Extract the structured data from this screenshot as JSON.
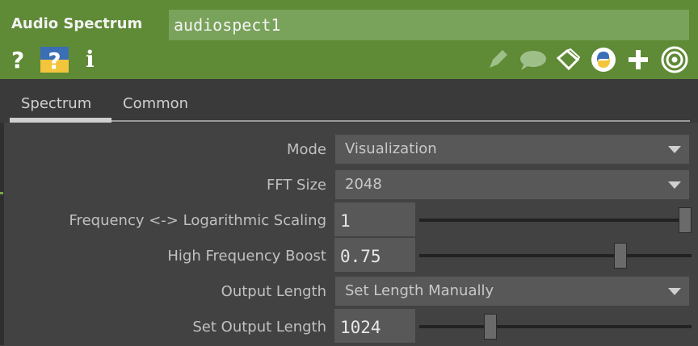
{
  "operator": {
    "type": "Audio Spectrum",
    "name": "audiospect1"
  },
  "header_icons": {
    "left": [
      "help-icon",
      "python-help-icon",
      "info-icon"
    ],
    "right": [
      "edit-icon",
      "comment-icon",
      "clone-icon",
      "python-icon",
      "add-icon",
      "target-icon"
    ]
  },
  "tabs": [
    {
      "label": "Spectrum",
      "active": true
    },
    {
      "label": "Common",
      "active": false
    }
  ],
  "params": {
    "mode": {
      "label": "Mode",
      "value": "Visualization"
    },
    "fft_size": {
      "label": "FFT Size",
      "value": "2048"
    },
    "log_scaling": {
      "label": "Frequency <-> Logarithmic Scaling",
      "value": "1",
      "slider_fraction": 1.0
    },
    "hf_boost": {
      "label": "High Frequency Boost",
      "value": "0.75",
      "slider_fraction": 0.75
    },
    "output_length": {
      "label": "Output Length",
      "value": "Set Length Manually"
    },
    "set_output_length": {
      "label": "Set Output Length",
      "value": "1024",
      "slider_fraction": 0.25
    }
  },
  "colors": {
    "header_bg": "#5f8a36",
    "name_field_bg": "#79a25a",
    "panel_bg": "#424242"
  }
}
